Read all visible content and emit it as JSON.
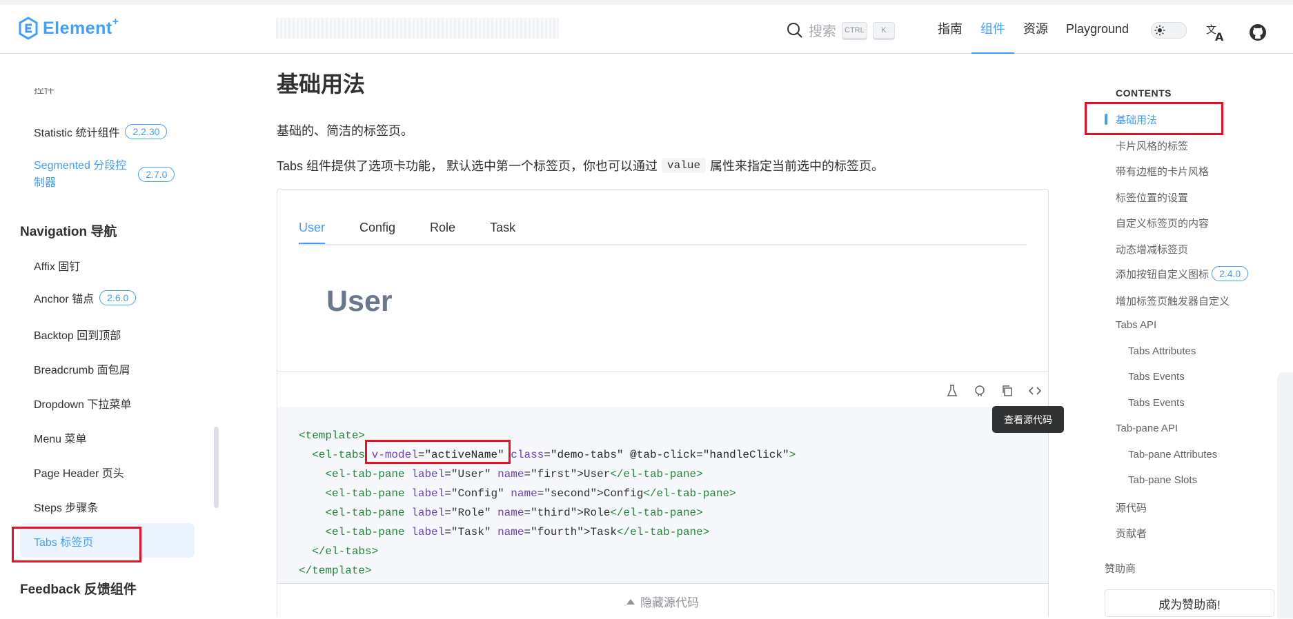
{
  "header": {
    "logo_text": "Element",
    "logo_plus": "+",
    "search_label": "搜索",
    "search_kbd_1": "CTRL",
    "search_kbd_2": "K",
    "nav": [
      "指南",
      "组件",
      "资源",
      "Playground"
    ],
    "active_nav_index": 1
  },
  "sidebar": {
    "partial_top": "控件",
    "statistic": {
      "label": "Statistic 统计组件",
      "badge": "2.2.30"
    },
    "segmented": {
      "label_line1": "Segmented 分段控",
      "label_line2": "制器",
      "badge": "2.7.0"
    },
    "group_navigation": "Navigation 导航",
    "items": [
      {
        "label": "Affix 固钉"
      },
      {
        "label": "Anchor 锚点",
        "badge": "2.6.0"
      },
      {
        "label": "Backtop 回到顶部"
      },
      {
        "label": "Breadcrumb 面包屑"
      },
      {
        "label": "Dropdown 下拉菜单"
      },
      {
        "label": "Menu 菜单"
      },
      {
        "label": "Page Header 页头"
      },
      {
        "label": "Steps 步骤条"
      },
      {
        "label": "Tabs 标签页"
      }
    ],
    "group_feedback": "Feedback 反馈组件"
  },
  "main": {
    "title": "基础用法",
    "p1": "基础的、简洁的标签页。",
    "p2_before": "Tabs 组件提供了选项卡功能， 默认选中第一个标签页，你也可以通过",
    "p2_code": "value",
    "p2_after": "属性来指定当前选中的标签页。",
    "tabs": [
      "User",
      "Config",
      "Role",
      "Task"
    ],
    "pane_content": "User",
    "tooltip": "查看源代码",
    "hide_code": "隐藏源代码",
    "code": {
      "l1": "<template>",
      "l2_open": "<el-tabs",
      "l2_vmodel_attr": "v-model",
      "l2_vmodel_val": "\"activeName\"",
      "l2_class_attr": "class",
      "l2_class_val": "\"demo-tabs\"",
      "l2_click_attr": "@tab-click",
      "l2_click_val": "\"handleClick\"",
      "l2_close": ">",
      "pane_tag_open": "<el-tab-pane",
      "pane_tag_close": "</el-tab-pane>",
      "label_attr": "label",
      "name_attr": "name",
      "panes": [
        {
          "label": "\"User\"",
          "name": "\"first\"",
          "text": ">User"
        },
        {
          "label": "\"Config\"",
          "name": "\"second\"",
          "text": ">Config"
        },
        {
          "label": "\"Role\"",
          "name": "\"third\"",
          "text": ">Role"
        },
        {
          "label": "\"Task\"",
          "name": "\"fourth\"",
          "text": ">Task"
        }
      ],
      "tabs_close": "</el-tabs>",
      "template_close": "</template>"
    }
  },
  "toc": {
    "heading": "CONTENTS",
    "items": [
      "基础用法",
      "卡片风格的标签",
      "带有边框的卡片风格",
      "标签位置的设置",
      "自定义标签页的内容",
      "动态增减标签页",
      "添加按钮自定义图标",
      "增加标签页触发器自定义",
      "Tabs API",
      "Tabs Attributes",
      "Tabs Events",
      "Tabs Events",
      "Tab-pane API",
      "Tab-pane Attributes",
      "Tab-pane Slots",
      "源代码",
      "贡献者"
    ],
    "badge_on_item_6": "2.4.0",
    "sponsor_label": "赞助商",
    "sponsor_button": "成为赞助商!"
  },
  "colors": {
    "primary": "#409eff",
    "annotation": "#e81123",
    "text": "#303133"
  }
}
